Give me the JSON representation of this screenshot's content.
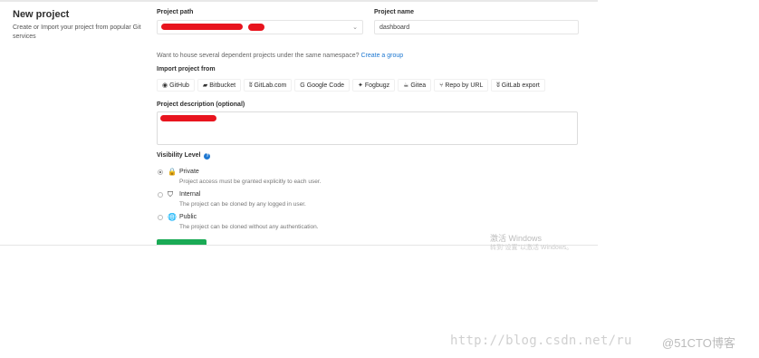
{
  "sidebar": {
    "title": "New project",
    "description": "Create or Import your project from popular Git services"
  },
  "form": {
    "project_path_label": "Project path",
    "project_name_label": "Project name",
    "project_name_value": "dashboard",
    "namespace_hint": "Want to house several dependent projects under the same namespace?",
    "create_group_link": "Create a group",
    "import_label": "Import project from",
    "import_sources": [
      {
        "label": "GitHub",
        "icon": "github-icon",
        "glyph": "◉"
      },
      {
        "label": "Bitbucket",
        "icon": "bitbucket-icon",
        "glyph": "▰"
      },
      {
        "label": "GitLab.com",
        "icon": "gitlab-icon",
        "glyph": "ʬ"
      },
      {
        "label": "Google Code",
        "icon": "google-icon",
        "glyph": "G"
      },
      {
        "label": "Fogbugz",
        "icon": "fogbugz-icon",
        "glyph": "✦"
      },
      {
        "label": "Gitea",
        "icon": "gitea-icon",
        "glyph": "☕"
      },
      {
        "label": "Repo by URL",
        "icon": "git-icon",
        "glyph": "⑂"
      },
      {
        "label": "GitLab export",
        "icon": "gitlab-export-icon",
        "glyph": "ʬ"
      }
    ],
    "description_label": "Project description (optional)",
    "visibility_label": "Visibility Level",
    "visibility_options": [
      {
        "name": "Private",
        "desc": "Project access must be granted explicitly to each user.",
        "icon": "lock-icon",
        "glyph": "🔒",
        "checked": true
      },
      {
        "name": "Internal",
        "desc": "The project can be cloned by any logged in user.",
        "icon": "shield-icon",
        "glyph": "⛉",
        "checked": false
      },
      {
        "name": "Public",
        "desc": "The project can be cloned without any authentication.",
        "icon": "globe-icon",
        "glyph": "🌐",
        "checked": false
      }
    ]
  },
  "watermarks": {
    "activate_title": "激活 Windows",
    "activate_sub": "转到\"设置\"以激活 Windows。",
    "url": "http://blog.csdn.net/ru",
    "author": "@51CTO博客"
  },
  "colors": {
    "redaction": "#e8141e",
    "link": "#1f78d1",
    "create_button": "#1aaa55"
  }
}
